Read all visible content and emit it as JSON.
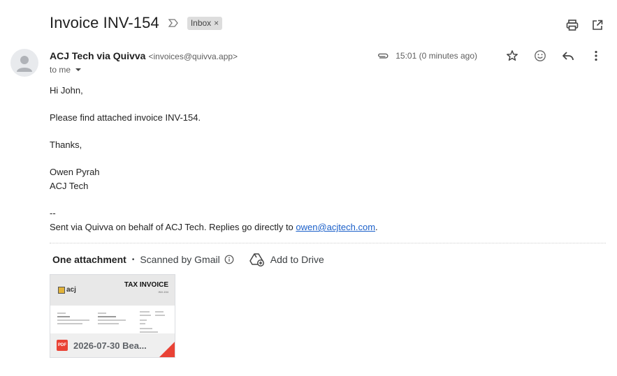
{
  "subject": "Invoice INV-154",
  "label_chip": {
    "text": "Inbox",
    "remove": "×"
  },
  "sender": {
    "name": "ACJ Tech via Quivva",
    "email": "<invoices@quivva.app>",
    "to": "to me"
  },
  "meta": {
    "time": "15:01 (0 minutes ago)"
  },
  "body": {
    "greeting": "Hi John,",
    "line1": "Please find attached invoice INV-154.",
    "thanks": "Thanks,",
    "sig_name": "Owen Pyrah",
    "sig_company": "ACJ Tech",
    "separator": "--",
    "footer_text": "Sent via Quivva on behalf of ACJ Tech. Replies go directly to ",
    "footer_link": "owen@acjtech.com",
    "footer_end": "."
  },
  "attachments": {
    "count_label": "One attachment",
    "dot": "•",
    "scanned": "Scanned by Gmail",
    "add_drive": "Add to Drive",
    "file": {
      "name": "2026-07-30 Bea...",
      "type": "PDF",
      "thumb_title": "TAX INVOICE",
      "thumb_sub": "INV-154",
      "thumb_logo": "acj"
    }
  },
  "colors": {
    "link": "#1a5fc9",
    "chip_bg": "#dddddd",
    "pdf_red": "#e94235"
  },
  "icons": [
    "importance-marker-icon",
    "print-icon",
    "open-new-window-icon",
    "attachment-clip-icon",
    "star-icon",
    "emoji-icon",
    "reply-icon",
    "more-vert-icon",
    "info-icon",
    "add-to-drive-icon",
    "pdf-icon",
    "avatar-person-icon"
  ]
}
